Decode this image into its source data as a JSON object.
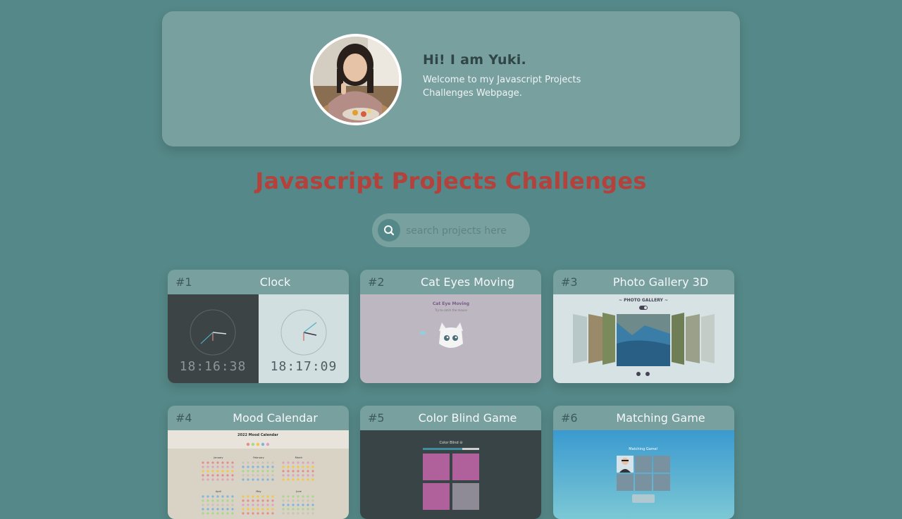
{
  "hero": {
    "title": "Hi! I am Yuki.",
    "subtitle": "Welcome to my Javascript Projects Challenges Webpage."
  },
  "page_title": "Javascript Projects Challenges",
  "search": {
    "placeholder": "search projects here",
    "icon": "search-icon"
  },
  "projects": [
    {
      "number": "#1",
      "title": "Clock",
      "thumb": {
        "dark_time": "18:16:38",
        "light_time": "18:17:09"
      }
    },
    {
      "number": "#2",
      "title": "Cat Eyes Moving",
      "thumb": {
        "heading": "Cat Eye Moving",
        "caption": "Try to catch the mouse"
      }
    },
    {
      "number": "#3",
      "title": "Photo Gallery 3D",
      "thumb": {
        "heading": "~ PHOTO GALLERY ~"
      }
    },
    {
      "number": "#4",
      "title": "Mood Calendar",
      "thumb": {
        "heading": "2022 Mood Calendar",
        "months": [
          "January",
          "February",
          "March",
          "April",
          "May",
          "June"
        ]
      }
    },
    {
      "number": "#5",
      "title": "Color Blind Game",
      "thumb": {
        "heading": "Color Blind ⊖"
      }
    },
    {
      "number": "#6",
      "title": "Matching Game",
      "thumb": {
        "heading": "Matching Game!"
      }
    }
  ],
  "colors": {
    "background": "#558888",
    "panel": "#78a09f",
    "title_red": "#b2423b",
    "text_dark": "#304545"
  }
}
